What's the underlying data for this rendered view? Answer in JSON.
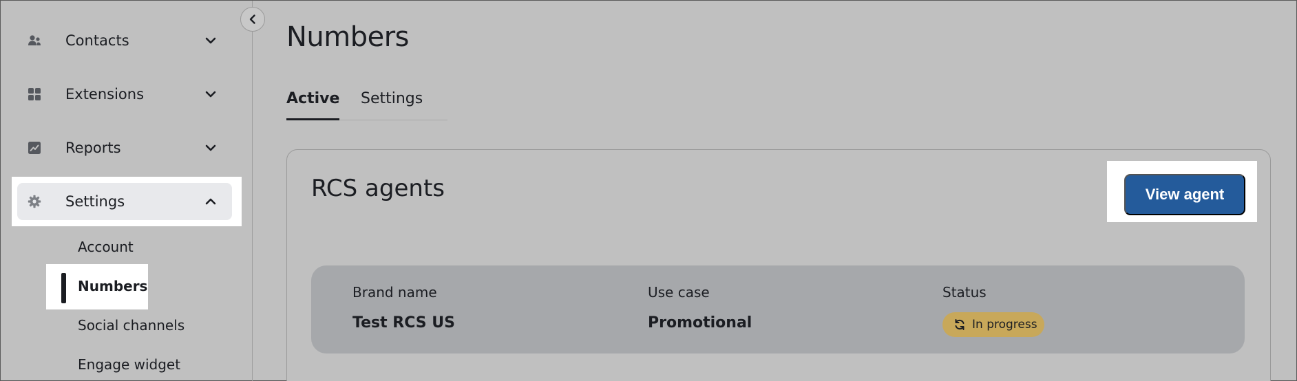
{
  "sidebar": {
    "items": [
      {
        "label": "Contacts",
        "icon": "contacts-icon",
        "expanded": false
      },
      {
        "label": "Extensions",
        "icon": "extensions-icon",
        "expanded": false
      },
      {
        "label": "Reports",
        "icon": "reports-icon",
        "expanded": false
      },
      {
        "label": "Settings",
        "icon": "gear-icon",
        "expanded": true
      }
    ],
    "sub_items": [
      "Account",
      "Numbers",
      "Social channels",
      "Engage widget"
    ],
    "active_sub_item": "Numbers"
  },
  "main": {
    "title": "Numbers",
    "tabs": [
      {
        "label": "Active",
        "active": true
      },
      {
        "label": "Settings",
        "active": false
      }
    ],
    "card": {
      "title": "RCS agents",
      "view_button": "View agent",
      "columns": [
        {
          "header": "Brand name",
          "value": "Test RCS US"
        },
        {
          "header": "Use case",
          "value": "Promotional"
        },
        {
          "header": "Status",
          "value": "In progress"
        }
      ]
    }
  },
  "colors": {
    "primary_button": "#245b9b",
    "status_badge": "#c8a85a",
    "background": "#c0c0c0"
  }
}
